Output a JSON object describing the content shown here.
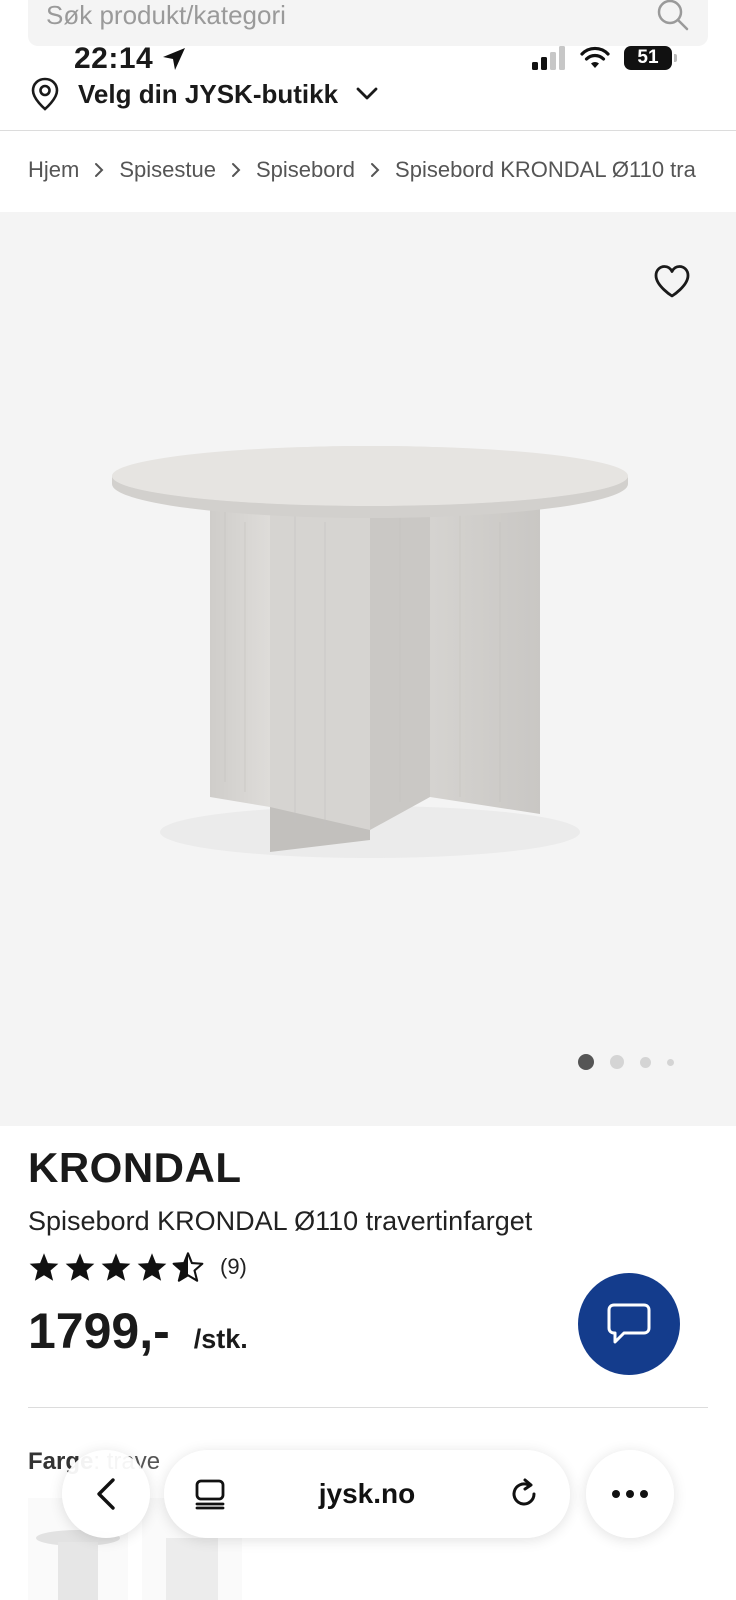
{
  "search": {
    "placeholder": "Søk produkt/kategori"
  },
  "status_bar": {
    "time": "22:14",
    "battery": "51"
  },
  "store": {
    "label": "Velg din JYSK-butikk"
  },
  "breadcrumb": [
    "Hjem",
    "Spisestue",
    "Spisebord",
    "Spisebord KRONDAL Ø110 tra"
  ],
  "gallery": {
    "slide_count": 4,
    "active_index": 0
  },
  "product": {
    "brand": "KRONDAL",
    "name": "Spisebord KRONDAL Ø110 travertinfarget",
    "rating": 4.5,
    "rating_count": "(9)",
    "price": "1799,-",
    "unit": "/stk."
  },
  "color_section": {
    "label": "Farge",
    "value_partial": "trave"
  },
  "browser": {
    "url": "jysk.no"
  },
  "colors": {
    "chat_button": "#143c8c",
    "image_bg": "#f4f4f4"
  }
}
